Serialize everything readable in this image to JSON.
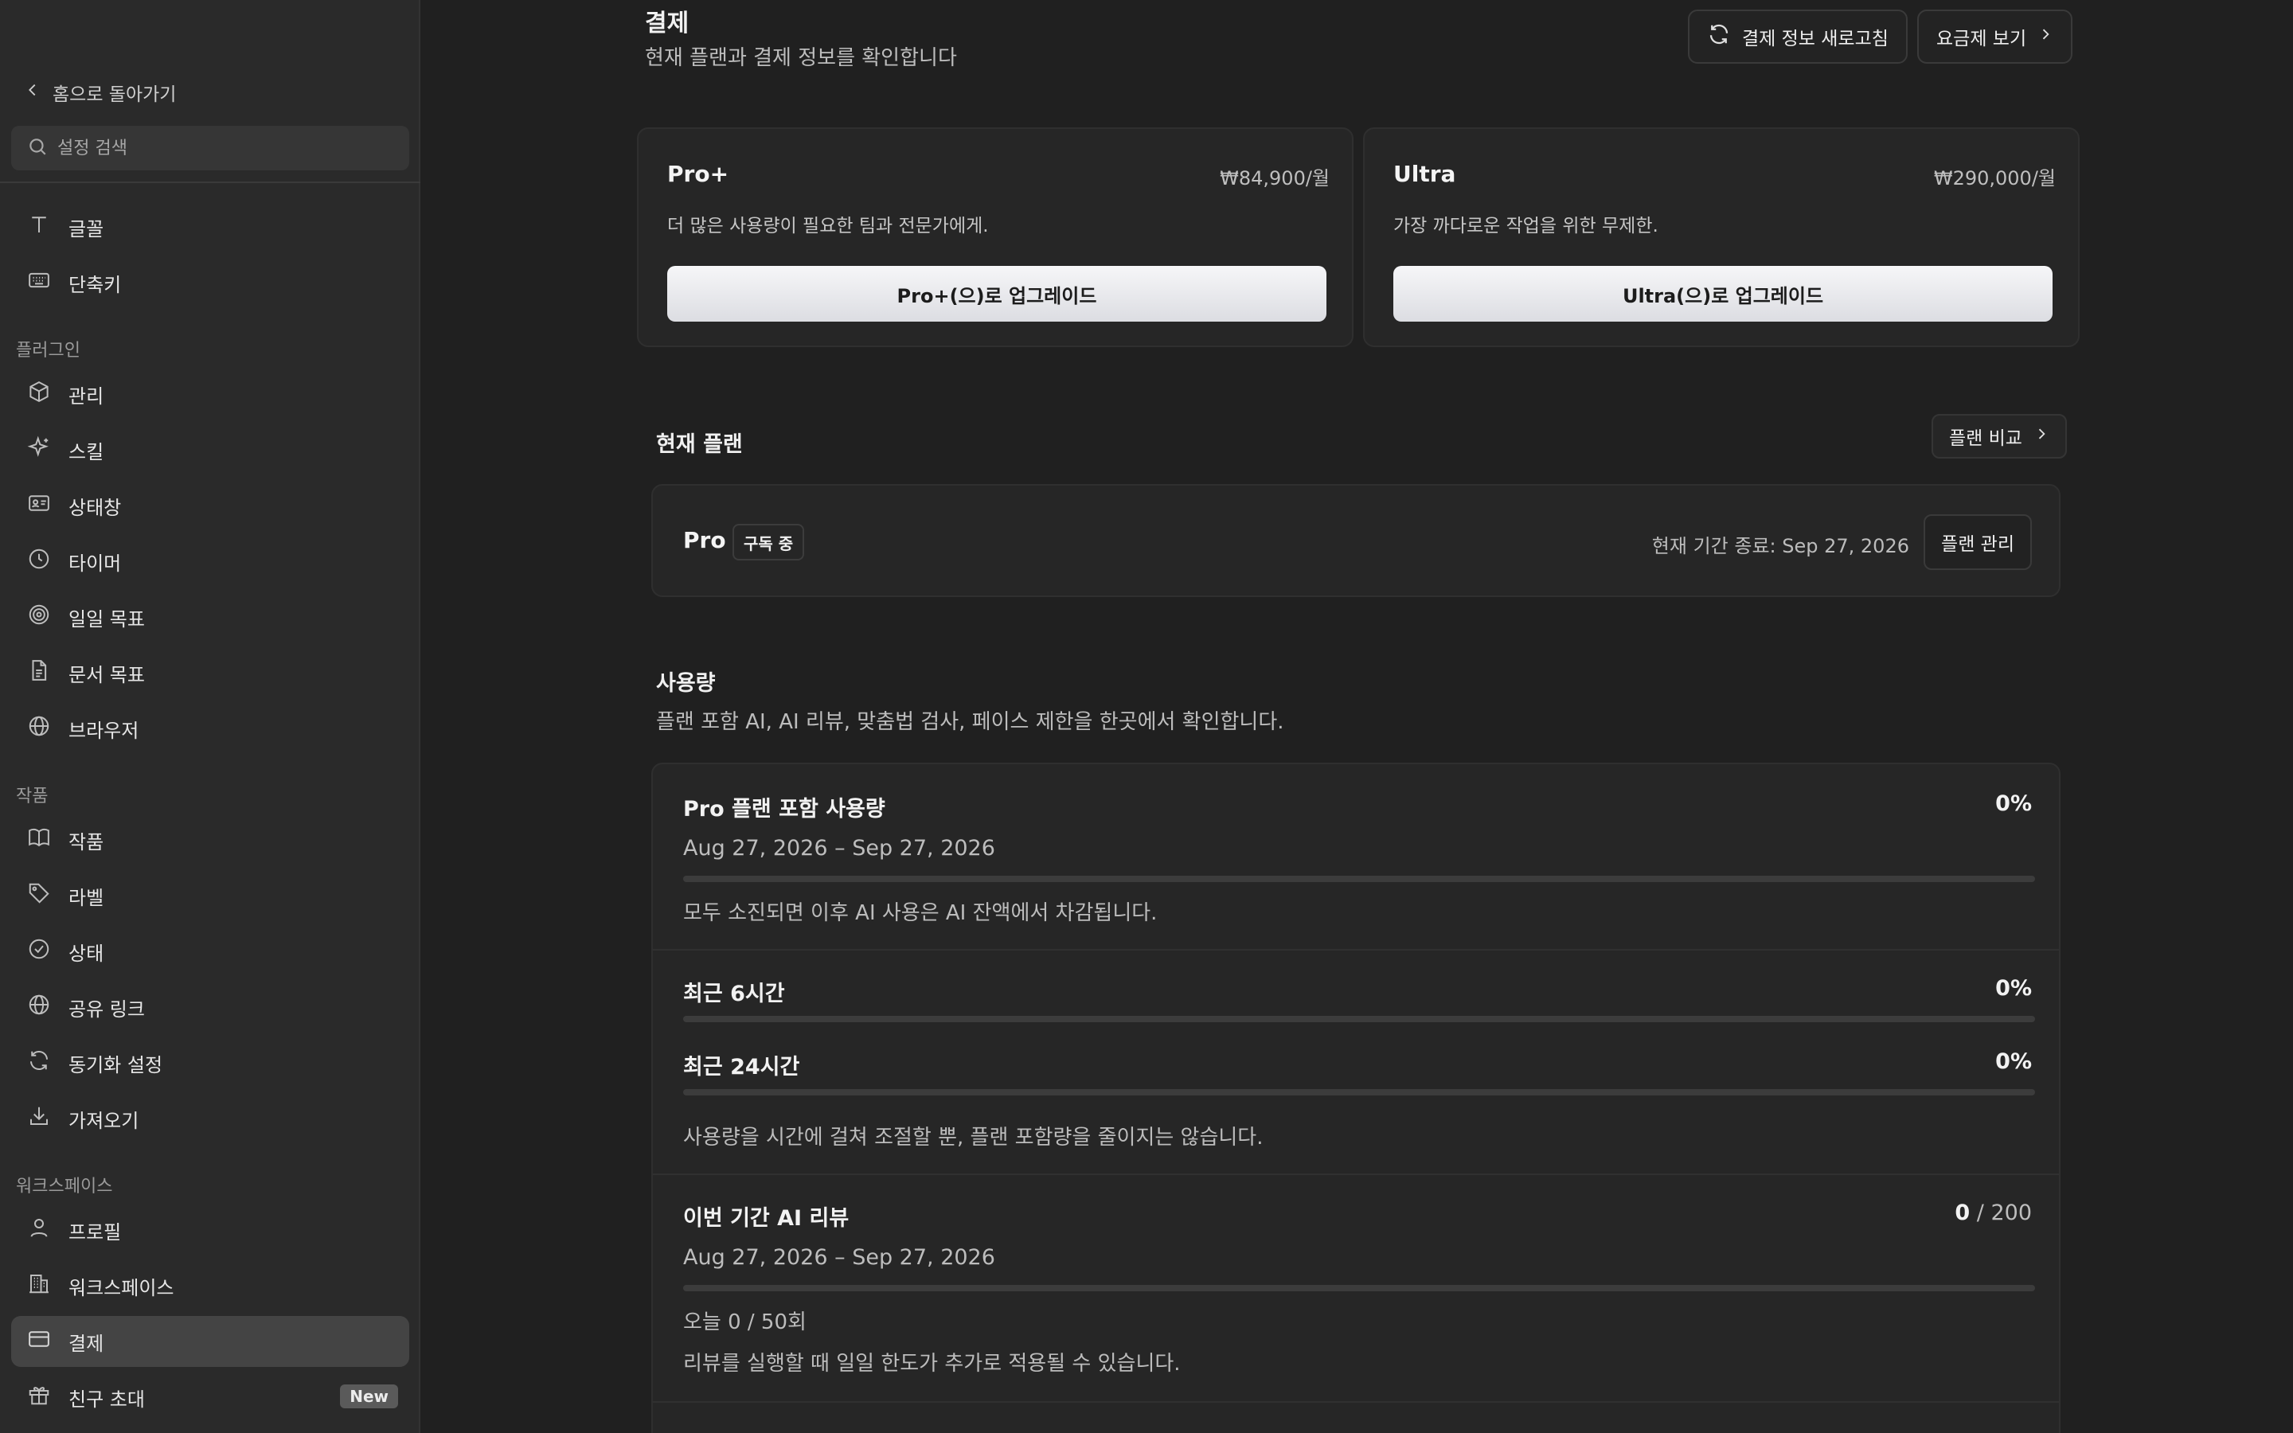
{
  "sidebar": {
    "back_label": "홈으로 돌아가기",
    "search_placeholder": "설정 검색",
    "items_top": [
      {
        "label": "글꼴",
        "icon": "font-icon"
      },
      {
        "label": "단축키",
        "icon": "keyboard-icon"
      }
    ],
    "section_plugins": "플러그인",
    "items_plugins": [
      {
        "label": "관리",
        "icon": "box-icon"
      },
      {
        "label": "스킬",
        "icon": "sparkle-icon"
      },
      {
        "label": "상태창",
        "icon": "id-card-icon"
      },
      {
        "label": "타이머",
        "icon": "clock-icon"
      },
      {
        "label": "일일 목표",
        "icon": "target-icon"
      },
      {
        "label": "문서 목표",
        "icon": "document-icon"
      },
      {
        "label": "브라우저",
        "icon": "globe-icon"
      }
    ],
    "section_works": "작품",
    "items_works": [
      {
        "label": "작품",
        "icon": "book-icon"
      },
      {
        "label": "라벨",
        "icon": "tag-icon"
      },
      {
        "label": "상태",
        "icon": "check-circle-icon"
      },
      {
        "label": "공유 링크",
        "icon": "globe-icon"
      },
      {
        "label": "동기화 설정",
        "icon": "sync-icon"
      },
      {
        "label": "가져오기",
        "icon": "download-icon"
      }
    ],
    "section_workspace": "워크스페이스",
    "items_workspace": [
      {
        "label": "프로필",
        "icon": "user-icon"
      },
      {
        "label": "워크스페이스",
        "icon": "building-icon"
      },
      {
        "label": "결제",
        "icon": "credit-card-icon",
        "active": true
      },
      {
        "label": "친구 초대",
        "icon": "gift-icon",
        "badge": "New"
      }
    ]
  },
  "header": {
    "title": "결제",
    "subtitle": "현재 플랜과 결제 정보를 확인합니다",
    "refresh_label": "결제 정보 새로고침",
    "pricing_label": "요금제 보기"
  },
  "plans": [
    {
      "name": "Pro+",
      "price": "₩84,900/월",
      "desc": "더 많은 사용량이 필요한 팀과 전문가에게.",
      "button": "Pro+(으)로 업그레이드"
    },
    {
      "name": "Ultra",
      "price": "₩290,000/월",
      "desc": "가장 까다로운 작업을 위한 무제한.",
      "button": "Ultra(으)로 업그레이드"
    }
  ],
  "current_plan": {
    "section_title": "현재 플랜",
    "compare_label": "플랜 비교",
    "name": "Pro",
    "badge": "구독 중",
    "period": "현재 기간 종료: Sep 27, 2026",
    "manage_label": "플랜 관리"
  },
  "usage": {
    "section_title": "사용량",
    "section_sub": "플랜 포함 AI, AI 리뷰, 맞춤법 검사, 페이스 제한을 한곳에서 확인합니다.",
    "included": {
      "title": "Pro 플랜 포함 사용량",
      "pct": "0%",
      "progress": 0,
      "date": "Aug 27, 2026 – Sep 27, 2026",
      "note": "모두 소진되면 이후 AI 사용은 AI 잔액에서 차감됩니다."
    },
    "recent6": {
      "title": "최근 6시간",
      "pct": "0%",
      "progress": 0
    },
    "recent24": {
      "title": "최근 24시간",
      "pct": "0%",
      "progress": 0
    },
    "pace_note": "사용량을 시간에 걸쳐 조절할 뿐, 플랜 포함량을 줄이지는 않습니다.",
    "review": {
      "title": "이번 기간 AI 리뷰",
      "used": "0",
      "total": "/ 200",
      "progress": 0,
      "date": "Aug 27, 2026 – Sep 27, 2026",
      "today": "오늘 0 / 50회",
      "note": "리뷰를 실행할 때 일일 한도가 추가로 적용될 수 있습니다."
    }
  }
}
